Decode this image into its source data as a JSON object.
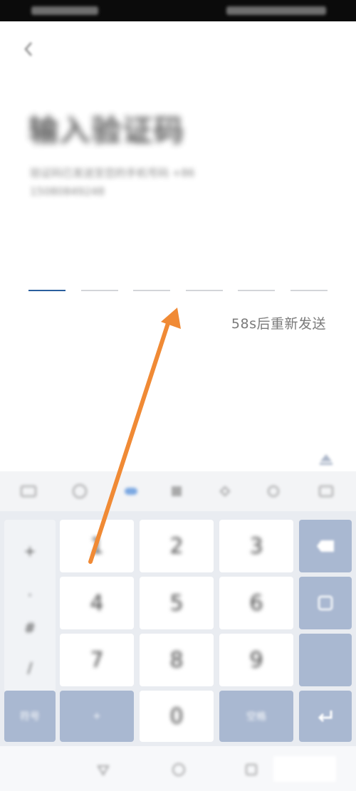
{
  "verification": {
    "title": "输入验证码",
    "subtitle": "验证码已发送至您的手机号码 +86 15080849248",
    "code_length": 6,
    "active_slot": 0,
    "resend_countdown": "58s后重新发送"
  },
  "toolbar": {
    "icons": [
      "keyboard-icon",
      "emoji-icon",
      "voice-icon",
      "grid-icon",
      "cursor-icon",
      "clipboard-icon",
      "settings-icon"
    ]
  },
  "keyboard": {
    "symbols": [
      "+",
      ".",
      "#",
      "/"
    ],
    "rows": [
      [
        "1",
        "2",
        "3"
      ],
      [
        "4",
        "5",
        "6"
      ],
      [
        "7",
        "8",
        "9"
      ]
    ],
    "bottom_row": {
      "left_label": "符号",
      "mid_left_label": "+",
      "zero": "0",
      "mid_right_label": "空格"
    },
    "accent_color": "#a9b8d1"
  },
  "colors": {
    "active_underline": "#2b5f9e",
    "annotation_arrow": "#f08a35"
  }
}
